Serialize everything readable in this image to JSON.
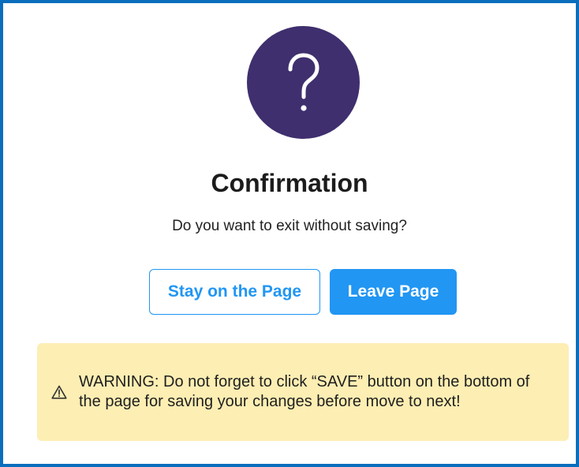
{
  "dialog": {
    "icon": "question-mark-icon",
    "icon_bg_color": "#3f2f6e",
    "title": "Confirmation",
    "message": "Do you want to exit without saving?",
    "buttons": {
      "stay_label": "Stay on the Page",
      "leave_label": "Leave Page"
    },
    "warning": {
      "icon": "warning-triangle-icon",
      "text": "WARNING: Do not forget to click “SAVE” button on the bottom of the page for saving your changes before move to next!",
      "bg_color": "#fdeeb3"
    },
    "colors": {
      "border": "#0a6ebd",
      "accent": "#2196f3"
    }
  }
}
